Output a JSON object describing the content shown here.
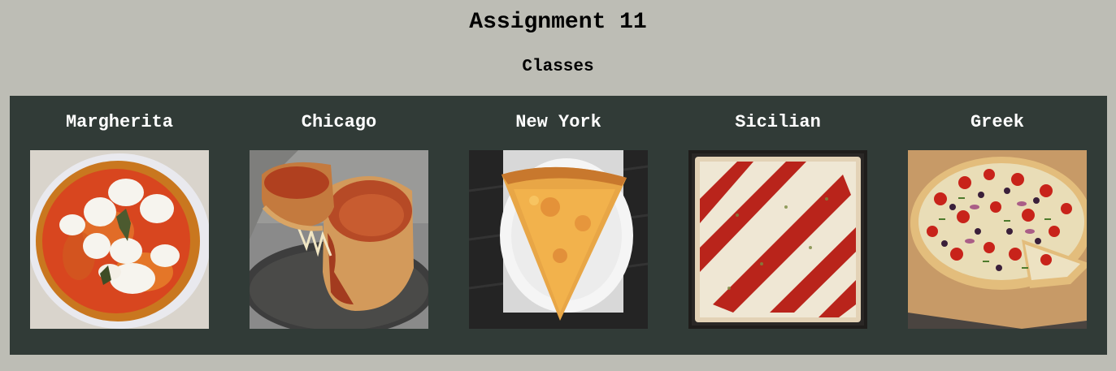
{
  "page": {
    "title": "Assignment 11",
    "subtitle": "Classes"
  },
  "pizzas": [
    {
      "name": "Margherita",
      "image": "margherita-pizza-photo"
    },
    {
      "name": "Chicago",
      "image": "chicago-deep-dish-pizza-photo"
    },
    {
      "name": "New York",
      "image": "new-york-pizza-slice-photo"
    },
    {
      "name": "Sicilian",
      "image": "sicilian-square-pizza-photo"
    },
    {
      "name": "Greek",
      "image": "greek-pizza-photo"
    }
  ],
  "colors": {
    "page_background": "#bdbdb5",
    "gallery_background": "#313b37",
    "card_title": "#ffffff"
  }
}
